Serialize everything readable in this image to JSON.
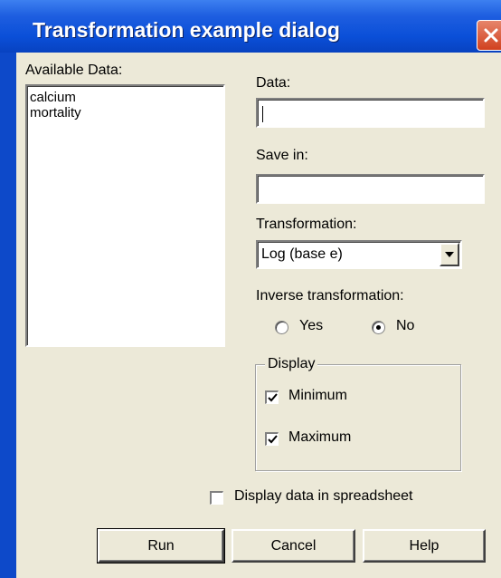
{
  "window": {
    "title": "Transformation example dialog"
  },
  "available": {
    "label": "Available Data:",
    "items": [
      "calcium",
      "mortality"
    ]
  },
  "data_field": {
    "label": "Data:",
    "value": ""
  },
  "save_field": {
    "label": "Save in:",
    "value": ""
  },
  "transformation": {
    "label": "Transformation:",
    "selected": "Log (base e)"
  },
  "inverse": {
    "label": "Inverse transformation:",
    "yes": "Yes",
    "no": "No",
    "selected": "No"
  },
  "display": {
    "title": "Display",
    "minimum": "Minimum",
    "maximum": "Maximum",
    "minimum_checked": true,
    "maximum_checked": true
  },
  "spreadsheet": {
    "label": "Display data in spreadsheet",
    "checked": false
  },
  "buttons": {
    "run": "Run",
    "cancel": "Cancel",
    "help": "Help"
  }
}
